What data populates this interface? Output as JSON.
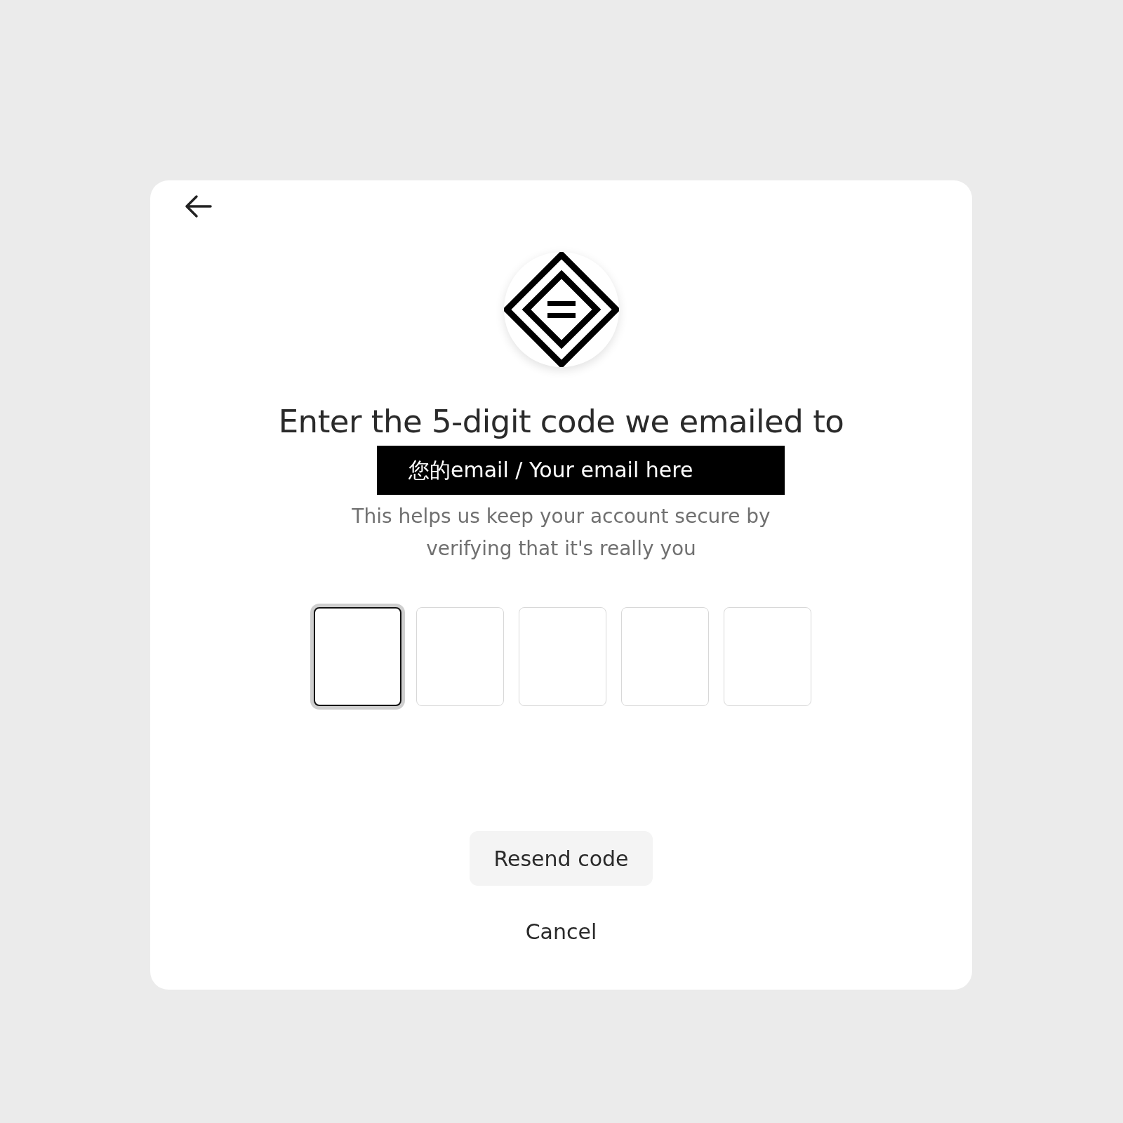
{
  "heading": "Enter the 5-digit code we emailed to",
  "email": "您的email / Your email here",
  "description": "This helps us keep your account secure by verifying that it's really you",
  "code_inputs": [
    {
      "selected": true
    },
    {
      "selected": false
    },
    {
      "selected": false
    },
    {
      "selected": false
    },
    {
      "selected": false
    }
  ],
  "buttons": [
    {
      "kind": "secondary",
      "label": "Resend code"
    },
    {
      "kind": "text",
      "label": "Cancel"
    }
  ]
}
